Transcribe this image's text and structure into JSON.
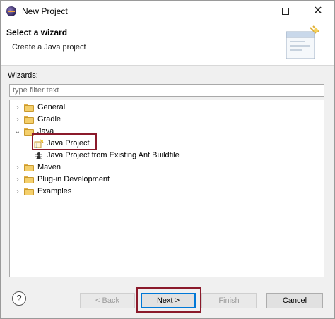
{
  "window": {
    "title": "New Project"
  },
  "banner": {
    "title": "Select a wizard",
    "description": "Create a Java project"
  },
  "wizards": {
    "label": "Wizards:",
    "filter_placeholder": "type filter text"
  },
  "tree": {
    "items": [
      {
        "label": "General",
        "expanded": false
      },
      {
        "label": "Gradle",
        "expanded": false
      },
      {
        "label": "Java",
        "expanded": true,
        "children": [
          {
            "label": "Java Project",
            "icon": "java-project-icon",
            "selected": true
          },
          {
            "label": "Java Project from Existing Ant Buildfile",
            "icon": "ant-buildfile-icon"
          }
        ]
      },
      {
        "label": "Maven",
        "expanded": false
      },
      {
        "label": "Plug-in Development",
        "expanded": false
      },
      {
        "label": "Examples",
        "expanded": false
      }
    ]
  },
  "footer": {
    "help": "?",
    "back_label": "< Back",
    "next_label": "Next >",
    "finish_label": "Finish",
    "cancel_label": "Cancel"
  },
  "colors": {
    "highlight": "#8b1a2b",
    "primary_border": "#0078d7",
    "folder": "#f4cf6b"
  }
}
